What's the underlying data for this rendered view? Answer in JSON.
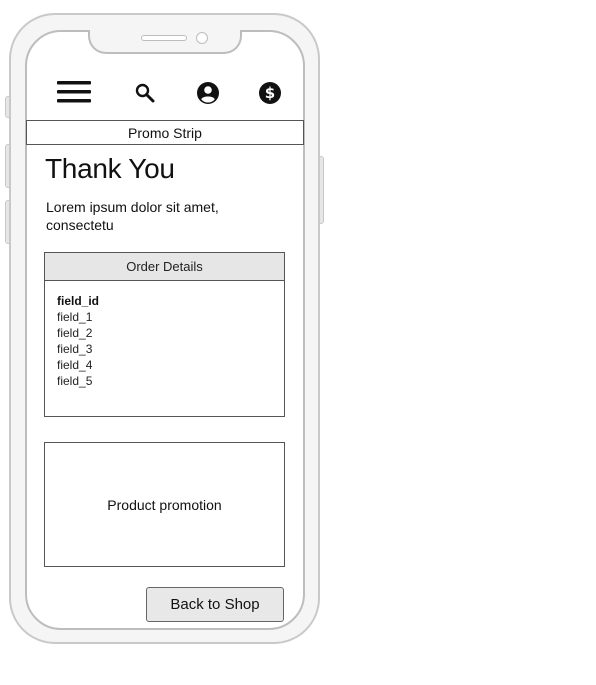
{
  "header": {
    "icons": [
      "menu-icon",
      "search-icon",
      "account-icon",
      "dollar-icon"
    ]
  },
  "promo_strip": {
    "label": "Promo Strip"
  },
  "main": {
    "title": "Thank You",
    "intro": "Lorem ipsum dolor sit amet, consectetu"
  },
  "order_details": {
    "header": "Order Details",
    "fields": [
      "field_id",
      "field_1",
      "field_2",
      "field_3",
      "field_4",
      "field_5"
    ]
  },
  "product_promotion": {
    "label": "Product promotion"
  },
  "actions": {
    "back_label": "Back to Shop"
  },
  "colors": {
    "frame": "#c9c9c9",
    "panel_header": "#e6e6e6",
    "button_bg": "#e8e8e8",
    "text": "#111111"
  }
}
